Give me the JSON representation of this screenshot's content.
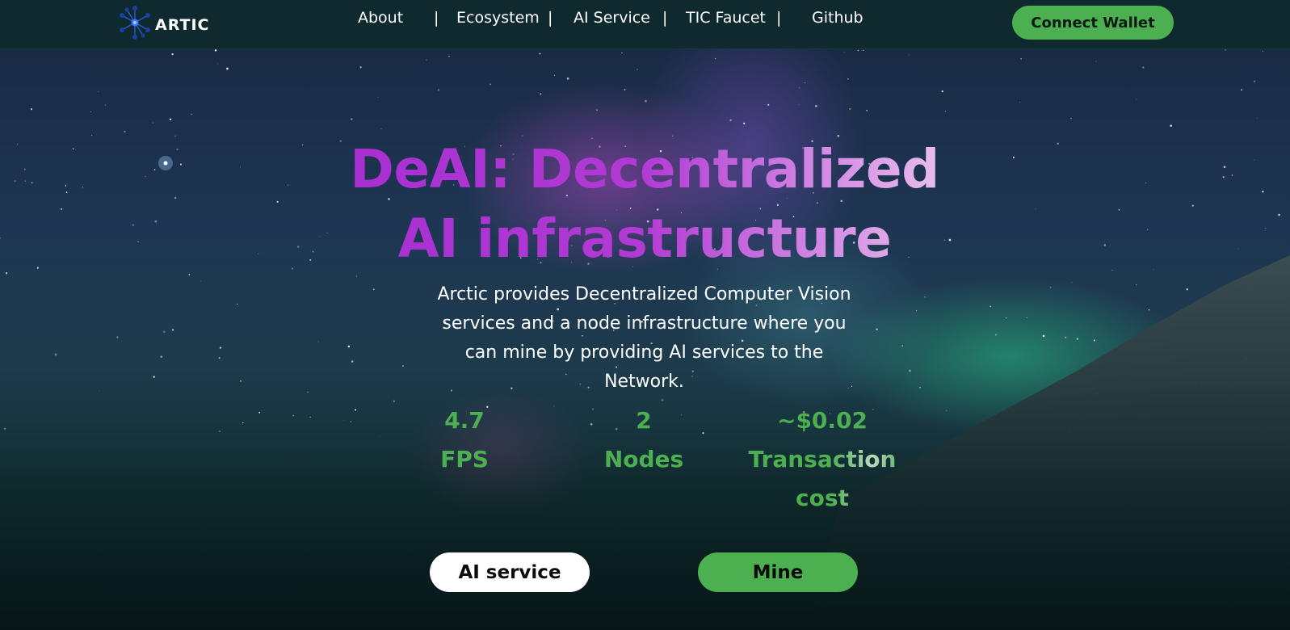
{
  "header": {
    "logo_text": "ARTIC",
    "nav": [
      {
        "label": "About"
      },
      {
        "label": "Ecosystem"
      },
      {
        "label": "AI Service"
      },
      {
        "label": "TIC Faucet"
      },
      {
        "label": "Github"
      }
    ],
    "separator": "|",
    "connect_label": "Connect Wallet"
  },
  "hero": {
    "title_line1": "DeAI: Decentralized",
    "title_line2": "AI infrastructure",
    "description": "Arctic provides Decentralized Computer Vision services and a node infrastructure where you can mine by providing AI services to the Network.",
    "stats": [
      {
        "value": "4.7",
        "label": "FPS"
      },
      {
        "value": "2",
        "label": "Nodes"
      },
      {
        "value": "~$0.02",
        "label": "Transaction cost"
      }
    ],
    "buttons": {
      "ai_service": "AI service",
      "mine": "Mine"
    }
  },
  "colors": {
    "accent_green": "#4caf50",
    "title_purple": "#a42bd0",
    "header_bg": "#0f2a2e"
  },
  "icons": [
    "artic-logo-icon"
  ]
}
